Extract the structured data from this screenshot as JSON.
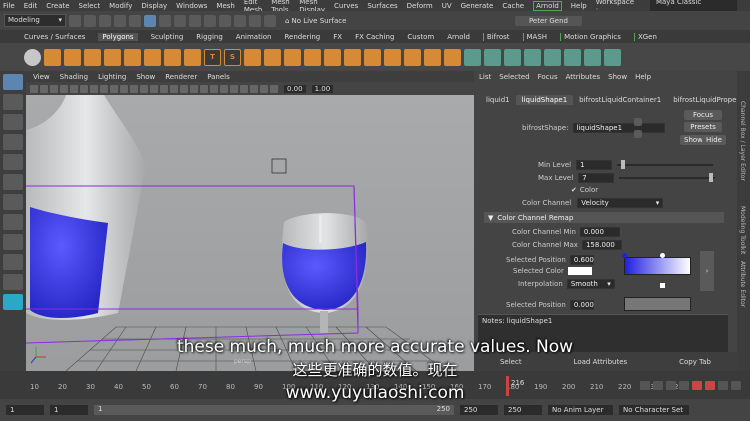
{
  "menubar": {
    "items": [
      "File",
      "Edit",
      "Create",
      "Select",
      "Modify",
      "Display",
      "Windows",
      "Mesh",
      "Edit Mesh",
      "Mesh Tools",
      "Mesh Display",
      "Curves",
      "Surfaces",
      "Deform",
      "UV",
      "Generate",
      "Cache",
      "Arnold",
      "Help"
    ],
    "workspace_label": "Workspace :",
    "workspace_value": "Maya Classic"
  },
  "statusline": {
    "mode": "Modeling",
    "live_surface": "No Live Surface",
    "user": "Peter Gend"
  },
  "shelf_tabs": [
    "Curves / Surfaces",
    "Polygons",
    "Sculpting",
    "Rigging",
    "Animation",
    "Rendering",
    "FX",
    "FX Caching",
    "Custom",
    "Arnold",
    "Bifrost",
    "MASH",
    "Motion Graphics",
    "XGen"
  ],
  "viewport": {
    "menu": [
      "View",
      "Shading",
      "Lighting",
      "Show",
      "Renderer",
      "Panels"
    ],
    "field1": "0.00",
    "field2": "1.00",
    "camera": "persp"
  },
  "attribute_editor": {
    "menu": [
      "List",
      "Selected",
      "Focus",
      "Attributes",
      "Show",
      "Help"
    ],
    "tabs": [
      "liquid1",
      "liquidShape1",
      "bifrostLiquidContainer1",
      "bifrostLiquidPropert"
    ],
    "shape_label": "bifrostShape:",
    "shape_value": "liquidShape1",
    "focus": "Focus",
    "presets": "Presets",
    "show": "Show",
    "hide": "Hide",
    "min_level_label": "Min Level",
    "min_level": "1",
    "max_level_label": "Max Level",
    "max_level": "7",
    "color_check": "Color",
    "color_channel_label": "Color Channel",
    "color_channel": "Velocity",
    "section_remap": "Color Channel Remap",
    "ccmin_label": "Color Channel Min",
    "ccmin": "0.000",
    "ccmax_label": "Color Channel Max",
    "ccmax": "158.000",
    "sel_pos_label": "Selected Position",
    "sel_pos": "0.600",
    "sel_color_label": "Selected Color",
    "interp_label": "Interpolation",
    "interp": "Smooth",
    "sel_pos2_label": "Selected Position",
    "sel_pos2": "0.000",
    "notes": "Notes: liquidShape1"
  },
  "bottom_buttons": [
    "Select",
    "Load Attributes",
    "Copy Tab"
  ],
  "side_tabs": [
    "Channel Box / Layer Editor",
    "Modeling Toolkit",
    "Attribute Editor"
  ],
  "timeline": {
    "ticks": [
      "10",
      "20",
      "30",
      "40",
      "50",
      "60",
      "70",
      "80",
      "90",
      "100",
      "110",
      "120",
      "130",
      "140",
      "150",
      "160",
      "170",
      "180",
      "190",
      "200",
      "210",
      "220",
      "230",
      "240"
    ],
    "current": "216"
  },
  "range": {
    "start": "1",
    "start2": "1",
    "slider_left": "1",
    "slider_right": "250",
    "end": "250",
    "end2": "250",
    "anim_layer": "No Anim Layer",
    "char_set": "No Character Set"
  },
  "subtitles": {
    "en": "these much, much more accurate values. Now",
    "zh": "这些更准确的数值。现在",
    "url": "www.yuyulaoshi.com"
  },
  "colors": {
    "liquid": "#3a3ad8",
    "accent_green": "#5aa45a",
    "shelf_orange": "#d78a36",
    "selection_purple": "#8a2be2"
  }
}
